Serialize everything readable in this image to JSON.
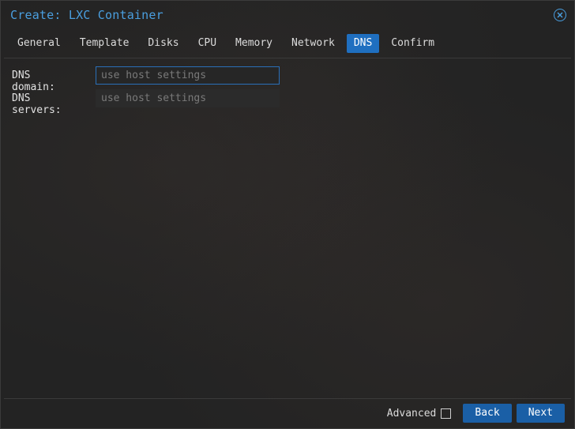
{
  "dialog": {
    "title": "Create: LXC Container",
    "close_icon": "close-circle-icon",
    "accent_color": "#4a9fe0"
  },
  "tabs": [
    {
      "label": "General",
      "active": false
    },
    {
      "label": "Template",
      "active": false
    },
    {
      "label": "Disks",
      "active": false
    },
    {
      "label": "CPU",
      "active": false
    },
    {
      "label": "Memory",
      "active": false
    },
    {
      "label": "Network",
      "active": false
    },
    {
      "label": "DNS",
      "active": true
    },
    {
      "label": "Confirm",
      "active": false
    }
  ],
  "form": {
    "dns_domain": {
      "label": "DNS domain:",
      "value": "",
      "placeholder": "use host settings"
    },
    "dns_servers": {
      "label": "DNS servers:",
      "value": "",
      "placeholder": "use host settings"
    }
  },
  "footer": {
    "advanced_label": "Advanced",
    "advanced_checked": false,
    "back_label": "Back",
    "next_label": "Next"
  }
}
